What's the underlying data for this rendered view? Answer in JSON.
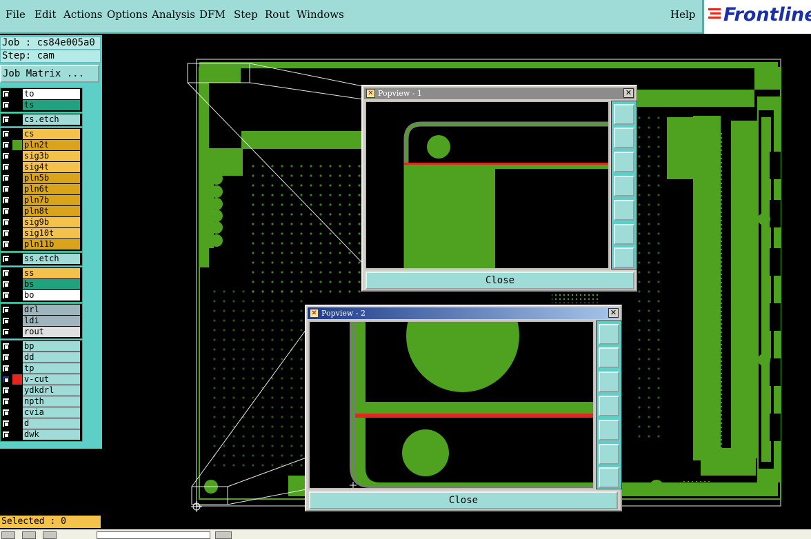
{
  "menu": {
    "file": "File",
    "edit": "Edit",
    "actions": "Actions",
    "options": "Options",
    "analysis": "Analysis",
    "dfm": "DFM",
    "step": "Step",
    "rout": "Rout",
    "windows": "Windows",
    "help": "Help"
  },
  "logo": {
    "text": "Frontline"
  },
  "job": {
    "job_line": "Job : cs84e005a0",
    "step_line": "Step: cam",
    "matrix_button": "Job Matrix ..."
  },
  "layers": [
    {
      "name": "to",
      "color": "#ffffff"
    },
    {
      "name": "ts",
      "color": "#1fa37f"
    },
    {
      "name": "cs.etch",
      "color": "#9fdcd8"
    },
    {
      "name": "cs",
      "color": "#f4c24a"
    },
    {
      "name": "pln2t",
      "color": "#d9a31c"
    },
    {
      "name": "sig3b",
      "color": "#f4c24a"
    },
    {
      "name": "sig4t",
      "color": "#f4c24a"
    },
    {
      "name": "pln5b",
      "color": "#d9a31c"
    },
    {
      "name": "pln6t",
      "color": "#d9a31c"
    },
    {
      "name": "pln7b",
      "color": "#d9a31c"
    },
    {
      "name": "pln8t",
      "color": "#d9a31c"
    },
    {
      "name": "sig9b",
      "color": "#f4c24a"
    },
    {
      "name": "sig10t",
      "color": "#f4c24a"
    },
    {
      "name": "pln11b",
      "color": "#d9a31c"
    },
    {
      "name": "ss.etch",
      "color": "#9fdcd8"
    },
    {
      "name": "ss",
      "color": "#f4c24a"
    },
    {
      "name": "bs",
      "color": "#1fa37f"
    },
    {
      "name": "bo",
      "color": "#ffffff"
    },
    {
      "name": "drl",
      "color": "#9fb5bd"
    },
    {
      "name": "ldi",
      "color": "#9fb5bd"
    },
    {
      "name": "rout",
      "color": "#e0e0e0"
    },
    {
      "name": "bp",
      "color": "#9fdcd8"
    },
    {
      "name": "dd",
      "color": "#9fdcd8"
    },
    {
      "name": "tp",
      "color": "#9fdcd8"
    },
    {
      "name": "v-cut",
      "color": "#9fdcd8"
    },
    {
      "name": "ydkdrl",
      "color": "#9fdcd8"
    },
    {
      "name": "npth",
      "color": "#9fdcd8"
    },
    {
      "name": "cvia",
      "color": "#9fdcd8"
    },
    {
      "name": "d",
      "color": "#9fdcd8"
    },
    {
      "name": "dwk",
      "color": "#9fdcd8"
    }
  ],
  "status": {
    "selected": "Selected : 0"
  },
  "popup1": {
    "title": "Popview - 1",
    "close_label": "Close"
  },
  "popup2": {
    "title": "Popview - 2",
    "close_label": "Close"
  },
  "colors": {
    "copper": "#4ea220",
    "highlight": "#e0281e",
    "panel": "#5ecfc6",
    "title_active": "#1d3a8a",
    "title_inactive": "#8c8c8c"
  },
  "toolbar_icons": [
    "zoom-home-icon",
    "pan-up-icon",
    "pan-down-icon",
    "pan-left-icon",
    "pan-right-icon",
    "zoom-in-icon",
    "zoom-out-icon"
  ]
}
